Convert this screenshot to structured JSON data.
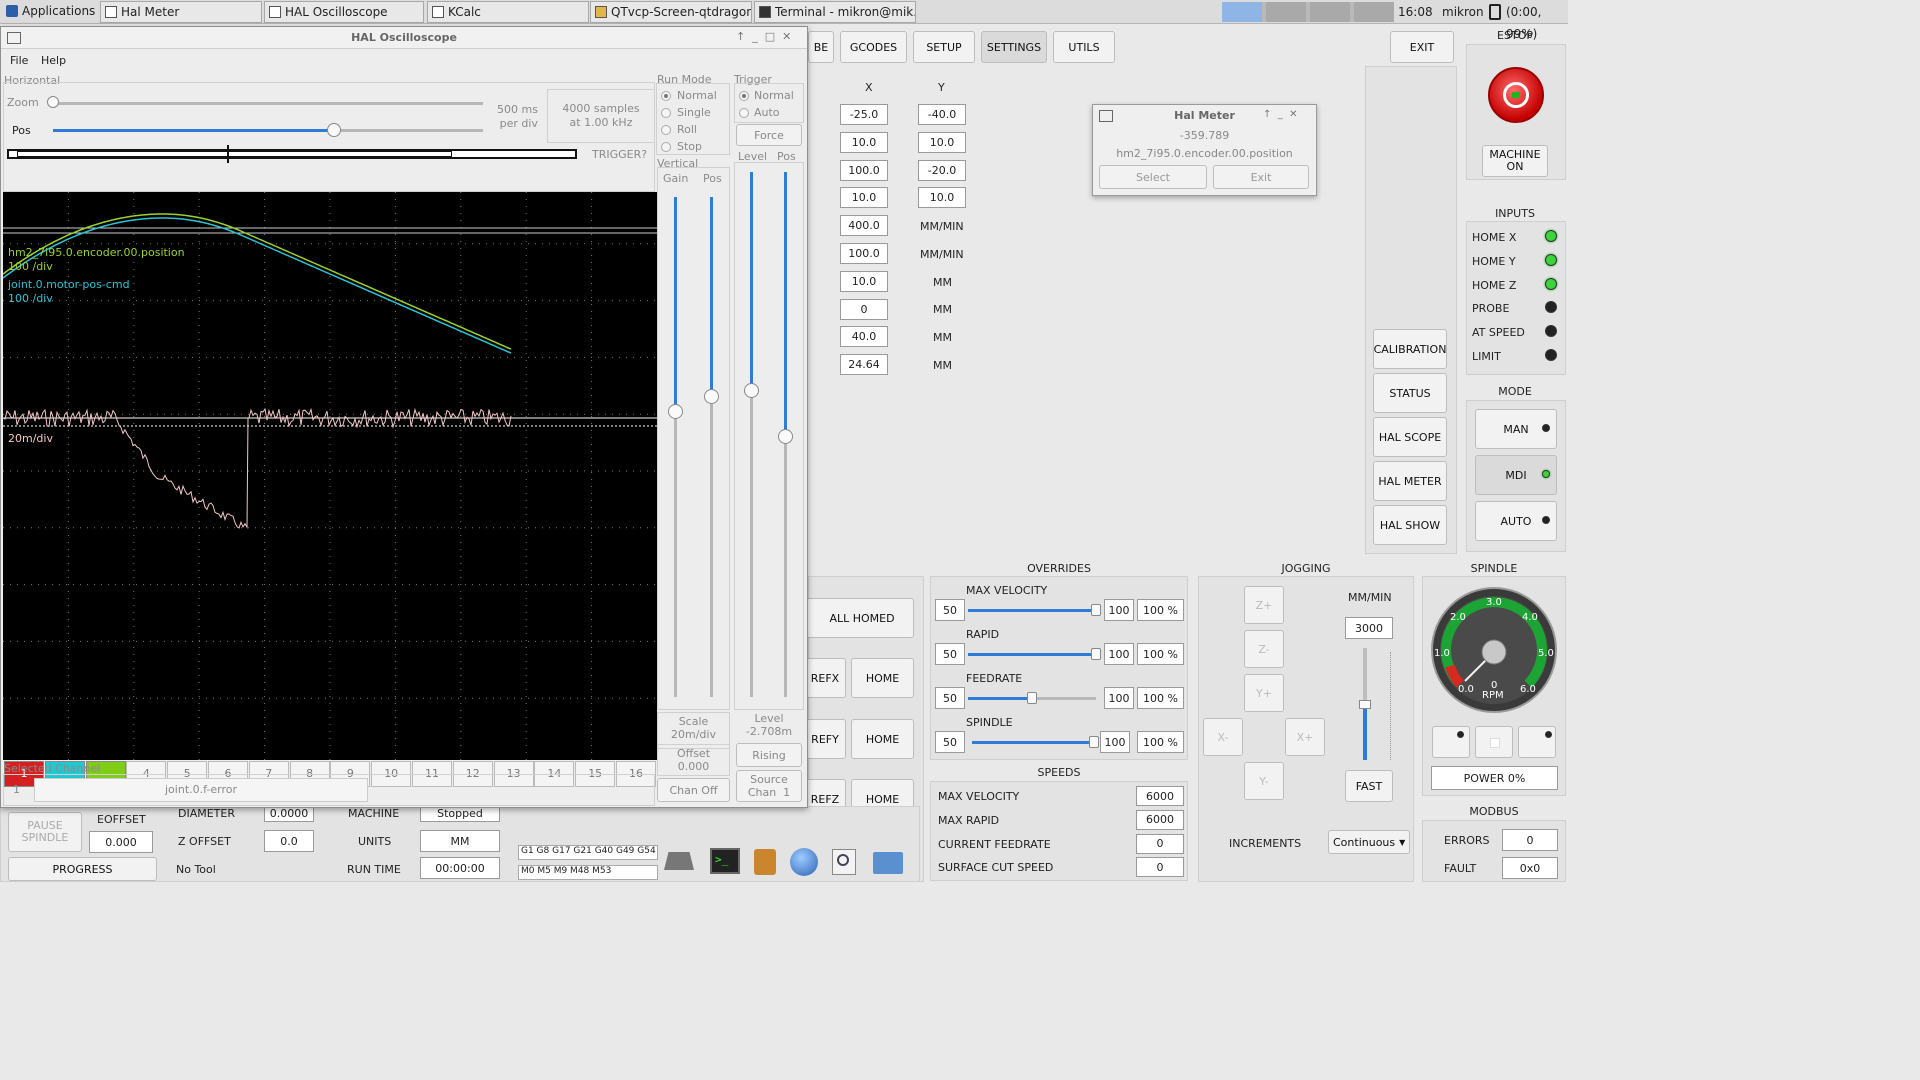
{
  "taskbar": {
    "applications": "Applications",
    "windows": [
      "Hal Meter",
      "HAL Oscilloscope",
      "KCalc",
      "QTvcp-Screen-qtdragon...",
      "Terminal - mikron@mik..."
    ],
    "clock": "16:08",
    "user": "mikron",
    "battery": "(0:00, 99%)"
  },
  "topnav": {
    "probe": "BE",
    "gcodes": "GCODES",
    "setup": "SETUP",
    "settings": "SETTINGS",
    "utils": "UTILS",
    "exit": "EXIT"
  },
  "settings_table": {
    "x_header": "X",
    "y_header": "Y",
    "x_values": [
      "-25.0",
      "10.0",
      "100.0",
      "10.0",
      "400.0",
      "100.0",
      "10.0",
      "0",
      "40.0",
      "24.64"
    ],
    "y_values": [
      "-40.0",
      "10.0",
      "-20.0",
      "10.0"
    ],
    "units": [
      "MM/MIN",
      "MM/MIN",
      "MM",
      "MM",
      "MM",
      "MM"
    ]
  },
  "right_buttons": {
    "calibration": "CALIBRATION",
    "status": "STATUS",
    "hal_scope": "HAL SCOPE",
    "hal_meter": "HAL METER",
    "hal_show": "HAL SHOW"
  },
  "estop": {
    "title": "ESTOP",
    "machine_on": "MACHINE\nON"
  },
  "inputs": {
    "title": "INPUTS",
    "items": [
      {
        "label": "HOME X",
        "on": true
      },
      {
        "label": "HOME Y",
        "on": true
      },
      {
        "label": "HOME Z",
        "on": true
      },
      {
        "label": "PROBE",
        "on": false
      },
      {
        "label": "AT SPEED",
        "on": false
      },
      {
        "label": "LIMIT",
        "on": false
      }
    ]
  },
  "mode": {
    "title": "MODE",
    "man": "MAN",
    "mdi": "MDI",
    "auto": "AUTO"
  },
  "hal_meter": {
    "title": "Hal Meter",
    "value": "-359.789",
    "pin": "hm2_7i95.0.encoder.00.position",
    "select": "Select",
    "exit": "Exit"
  },
  "overrides": {
    "title": "OVERRIDES",
    "rows": [
      {
        "label": "MAX VELOCITY",
        "min": "50",
        "value": "100",
        "pct": "100 %",
        "level": 1.0
      },
      {
        "label": "RAPID",
        "min": "50",
        "value": "100",
        "pct": "100 %",
        "level": 1.0
      },
      {
        "label": "FEEDRATE",
        "min": "50",
        "value": "100",
        "pct": "100 %",
        "level": 0.5
      },
      {
        "label": "SPINDLE",
        "min": "50",
        "value": "100",
        "pct": "100 %",
        "level": 1.0
      }
    ]
  },
  "speeds": {
    "title": "SPEEDS",
    "rows": [
      {
        "label": "MAX VELOCITY",
        "value": "6000"
      },
      {
        "label": "MAX RAPID",
        "value": "6000"
      },
      {
        "label": "CURRENT FEEDRATE",
        "value": "0"
      },
      {
        "label": "SURFACE CUT SPEED",
        "value": "0"
      }
    ]
  },
  "homing": {
    "all_homed": "ALL HOMED",
    "refx": "REFX",
    "refy": "REFY",
    "refz": "REFZ",
    "home": "HOME"
  },
  "jogging": {
    "title": "JOGGING",
    "units": "MM/MIN",
    "rate": "3000",
    "fast": "FAST",
    "increments_label": "INCREMENTS",
    "increments_value": "Continuous",
    "keys": [
      "Z+",
      "Z-",
      "Y+",
      "X-",
      "X+",
      "Y-"
    ]
  },
  "spindle": {
    "title": "SPINDLE",
    "rpm_label": "RPM",
    "scale": [
      "0.0",
      "1.0",
      "2.0",
      "3.0",
      "4.0",
      "5.0",
      "6.0"
    ],
    "rpm_value": "0",
    "power": "POWER 0%"
  },
  "modbus": {
    "title": "MODBUS",
    "errors_label": "ERRORS",
    "errors_value": "0",
    "fault_label": "FAULT",
    "fault_value": "0x0"
  },
  "bottom_left": {
    "pause_spindle": "PAUSE\nSPINDLE",
    "progress": "PROGRESS",
    "eoffset_label": "EOFFSET",
    "eoffset_value": "0.000",
    "diameter_label": "DIAMETER",
    "diameter_value": "0.0000",
    "zoffset_label": "Z OFFSET",
    "zoffset_value": "0.0",
    "tool": "No Tool",
    "machine_label": "MACHINE",
    "machine_value": "Stopped",
    "units_label": "UNITS",
    "units_value": "MM",
    "runtime_label": "RUN TIME",
    "runtime_value": "00:00:00",
    "gcodes": "G1 G8 G17 G21 G40 G49 G54",
    "mcodes": "M0 M5 M9 M48 M53"
  },
  "scope": {
    "title": "HAL Oscilloscope",
    "menu": [
      "File",
      "Help"
    ],
    "horizontal": "Horizontal",
    "zoom": "Zoom",
    "pos": "Pos",
    "timebase": "500 ms\nper div",
    "samples": "4000 samples\nat 1.00 kHz",
    "trigger_status": "TRIGGER?",
    "run_mode": {
      "title": "Run Mode",
      "options": [
        "Normal",
        "Single",
        "Roll",
        "Stop"
      ],
      "selected": 0
    },
    "trigger": {
      "title": "Trigger",
      "options": [
        "Normal",
        "Auto"
      ],
      "selected": 0,
      "force": "Force",
      "level": "Level",
      "pos": "Pos"
    },
    "vertical": {
      "title": "Vertical",
      "gain": "Gain",
      "pos": "Pos"
    },
    "traces": [
      {
        "name": "hm2_7i95.0.encoder.00.position",
        "scale": "100 /div",
        "color": "#9bd22b"
      },
      {
        "name": "joint.0.motor-pos-cmd",
        "scale": "100 /div",
        "color": "#27c4d6"
      },
      {
        "name": "",
        "scale": "20m/div",
        "color": "#f3c6c6"
      }
    ],
    "scale_label": "Scale",
    "scale_value": "20m/div",
    "offset_label": "Offset",
    "offset_value": "0.000",
    "chan_off": "Chan Off",
    "level_label": "Level",
    "level_value": "-2.708m",
    "rising": "Rising",
    "source": "Source\nChan  1",
    "channels": [
      "1",
      "2",
      "3",
      "4",
      "5",
      "6",
      "7",
      "8",
      "9",
      "10",
      "11",
      "12",
      "13",
      "14",
      "15",
      "16"
    ],
    "selected_channel_label": "Selected Channel",
    "selected_channel_num": "1",
    "selected_channel_pin": "joint.0.f-error"
  },
  "colors": {
    "ch1": "#d42020",
    "ch2": "#1fc9d1",
    "ch3": "#7fcd16",
    "accent": "#2f7bd8"
  }
}
